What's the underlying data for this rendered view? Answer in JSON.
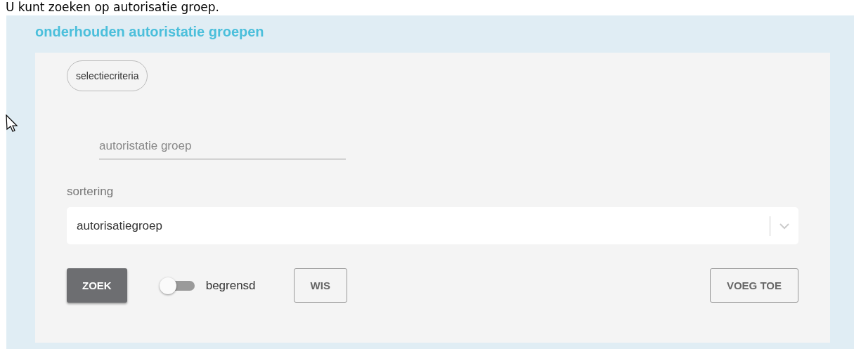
{
  "intro_text": "U kunt zoeken op autorisatie groep.",
  "panel": {
    "title": "onderhouden autoristatie groepen",
    "chip": "selectiecriteria",
    "search_field": {
      "placeholder": "autoristatie groep"
    },
    "sort": {
      "label": "sortering",
      "value": "autorisatiegroep"
    },
    "actions": [
      {
        "kind": "primary",
        "label": "ZOEK"
      },
      {
        "kind": "toggle",
        "label": "begrensd",
        "on": false
      },
      {
        "kind": "outline",
        "label": "WIS"
      },
      {
        "kind": "outline-right",
        "label": "VOEG TOE"
      }
    ]
  }
}
